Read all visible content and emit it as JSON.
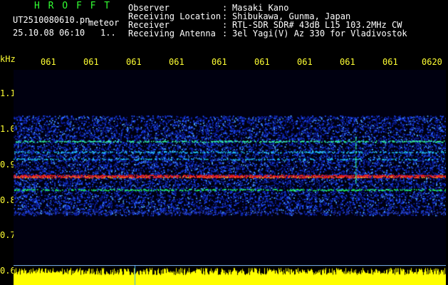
{
  "header": {
    "brand": "H R O F F T",
    "filename": "UT2510080610.pn",
    "meteor_label": "meteor",
    "datetime": "25.10.08 06:10",
    "mark": "1..",
    "fields": [
      {
        "label": "Observer",
        "value": "Masaki Kano"
      },
      {
        "label": "Receiving Location",
        "value": "Shibukawa, Gunma, Japan"
      },
      {
        "label": "Receiver",
        "value": "RTL-SDR SDR# 43dB L15 103.2MHz CW"
      },
      {
        "label": "Receiving Antenna",
        "value": "3el Yagi(V) Az 330 for Vladivostok"
      }
    ]
  },
  "axis": {
    "unit": "kHz",
    "time_ticks": [
      "061",
      "061",
      "061",
      "061",
      "061",
      "061",
      "061",
      "061",
      "061",
      "0620"
    ],
    "freq_ticks": [
      "1.1",
      "1.0",
      "0.9",
      "0.8",
      "0.7",
      "0.6"
    ]
  },
  "colors": {
    "header_green": "#33ff33",
    "label_yellow": "#ffff33",
    "signal_red": "#ff2020",
    "noise_blue": "#1a3cff",
    "meter_yellow": "#ffff00"
  }
}
